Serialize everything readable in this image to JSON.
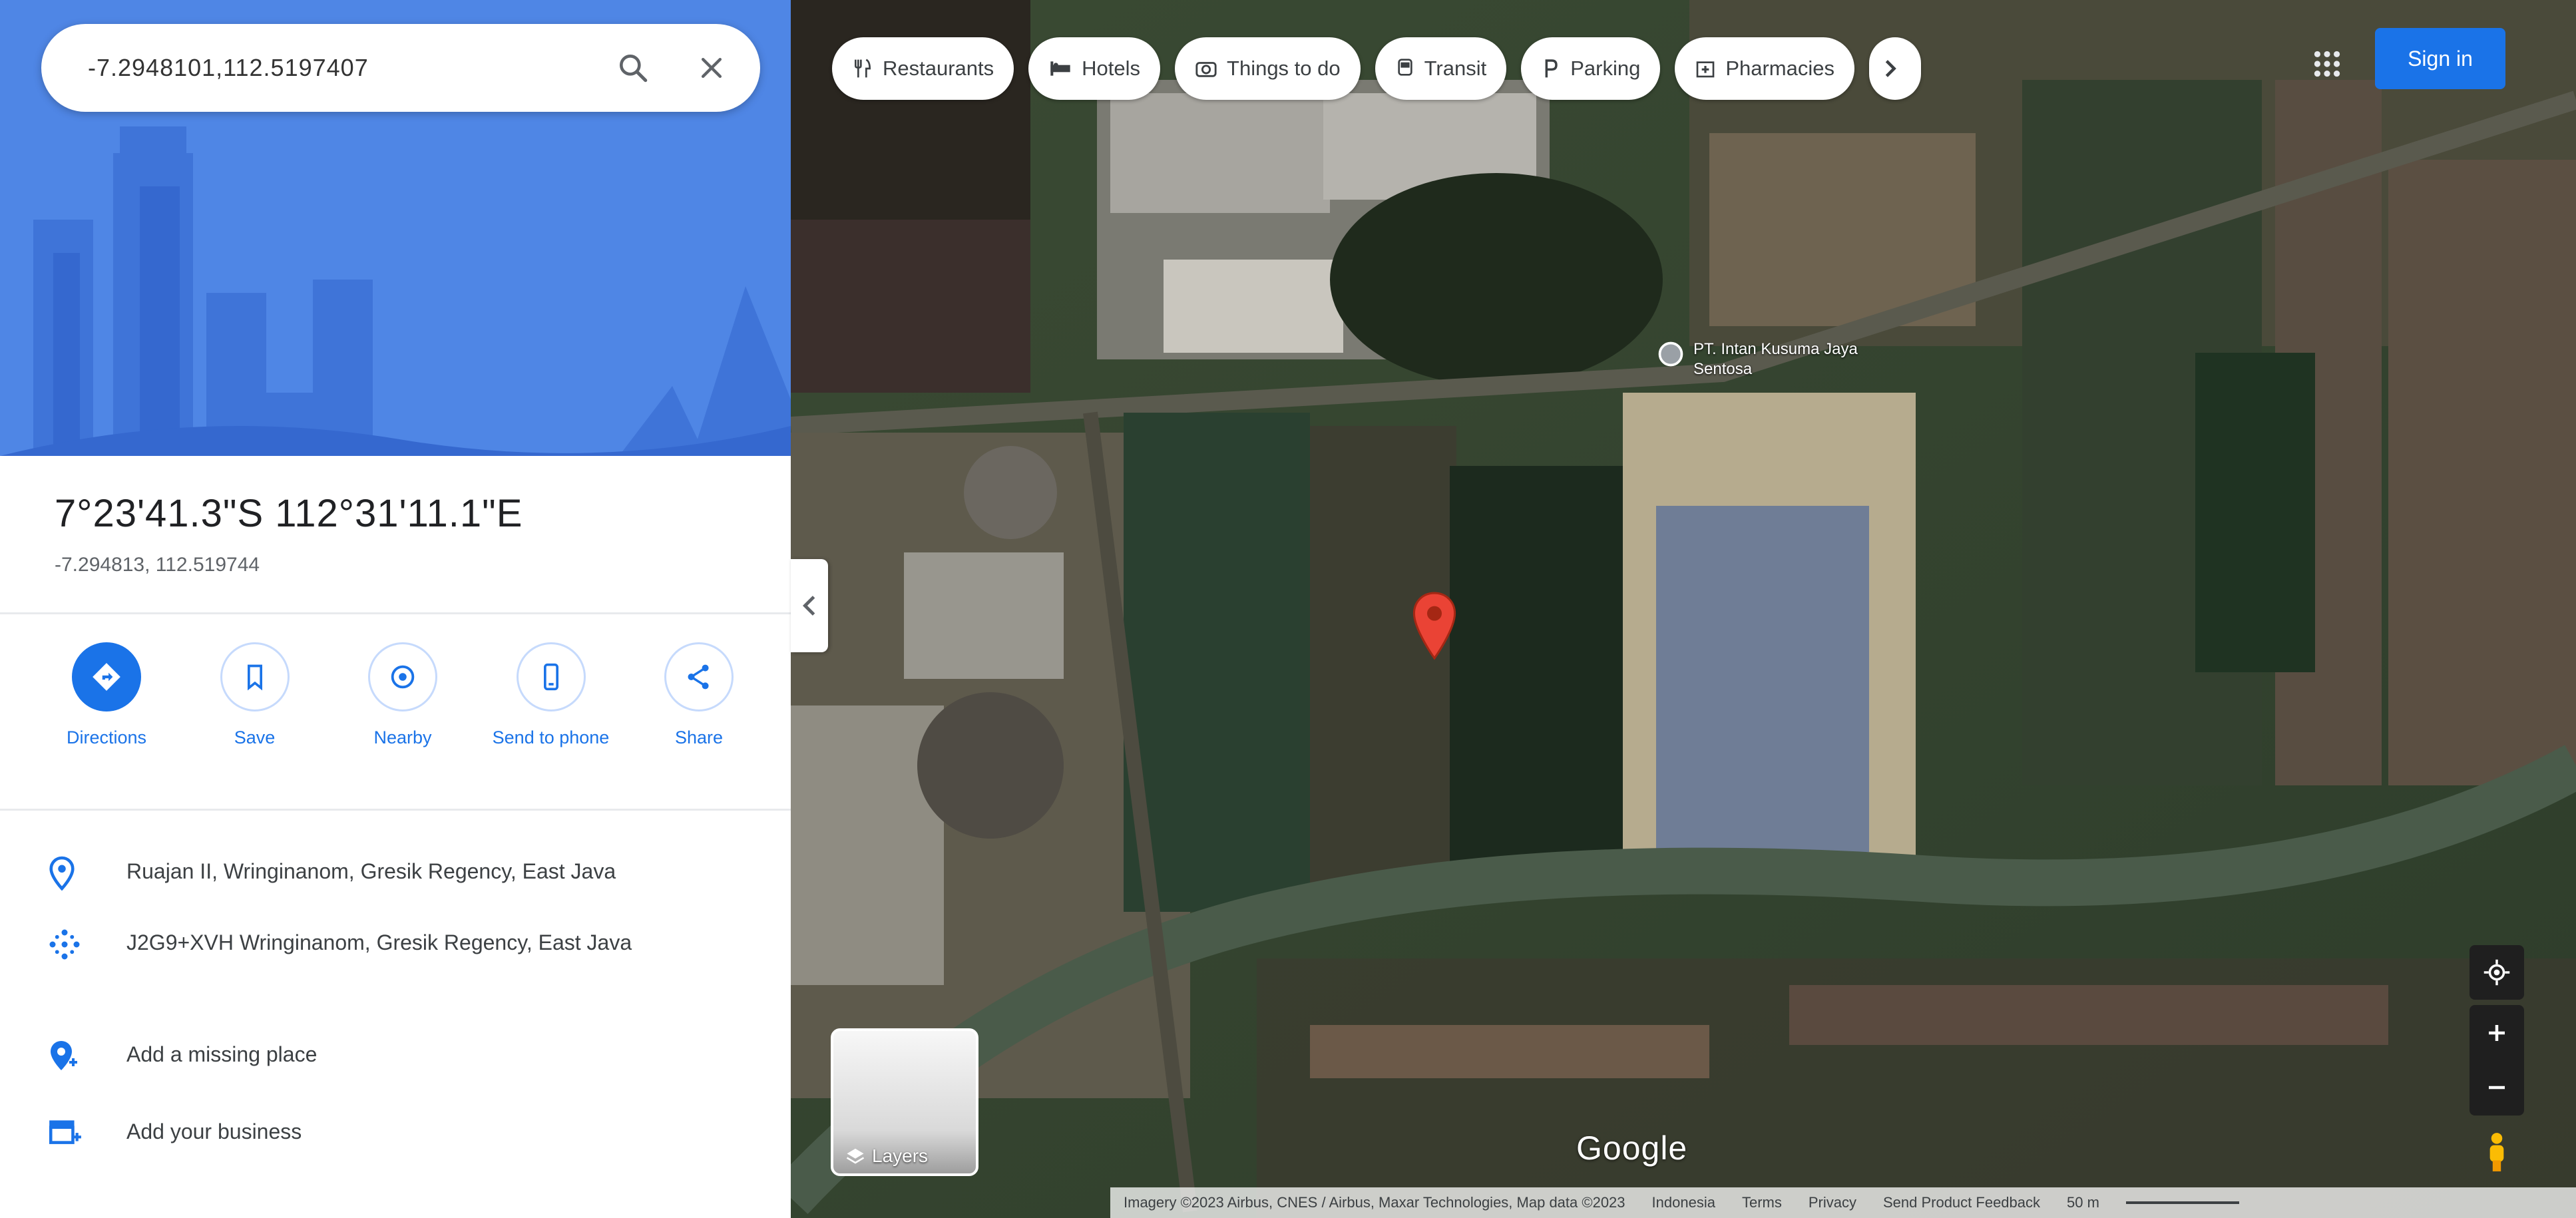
{
  "search": {
    "value": "-7.2948101,112.5197407",
    "search_label": "Search",
    "close_label": "Close"
  },
  "place": {
    "title": "7°23'41.3\"S 112°31'11.1\"E",
    "subtitle": "-7.294813, 112.519744"
  },
  "actions": [
    {
      "label": "Directions",
      "icon": "directions-icon"
    },
    {
      "label": "Save",
      "icon": "bookmark-icon"
    },
    {
      "label": "Nearby",
      "icon": "nearby-icon"
    },
    {
      "label": "Send to phone",
      "icon": "phone-icon"
    },
    {
      "label": "Share",
      "icon": "share-icon"
    }
  ],
  "info": [
    {
      "text": "Ruajan II, Wringinanom, Gresik Regency, East Java",
      "icon": "location-pin-icon"
    },
    {
      "text": "J2G9+XVH Wringinanom, Gresik Regency, East Java",
      "icon": "plus-code-icon"
    },
    {
      "text": "Add a missing place",
      "icon": "add-place-icon"
    },
    {
      "text": "Add your business",
      "icon": "business-icon"
    }
  ],
  "map": {
    "chips": [
      {
        "label": "Restaurants",
        "icon": "restaurant-icon"
      },
      {
        "label": "Hotels",
        "icon": "hotel-icon"
      },
      {
        "label": "Things to do",
        "icon": "camera-icon"
      },
      {
        "label": "Transit",
        "icon": "transit-icon"
      },
      {
        "label": "Parking",
        "icon": "parking-icon"
      },
      {
        "label": "Pharmacies",
        "icon": "pharmacy-icon"
      }
    ],
    "sign_in": "Sign in",
    "poi_label": "PT. Intan Kusuma Jaya Sentosa",
    "layers_label": "Layers",
    "logo": "Google",
    "footer": [
      "Imagery ©2023 Airbus, CNES / Airbus, Maxar Technologies, Map data ©2023",
      "Indonesia",
      "Terms",
      "Privacy",
      "Send Product Feedback",
      "50 m"
    ]
  },
  "colors": {
    "accent": "#1a73e8",
    "hero": "#4f86e5",
    "pin": "#ea4335"
  }
}
